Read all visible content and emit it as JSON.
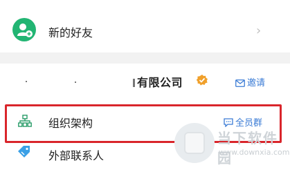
{
  "new_friends": {
    "label": "新的好友",
    "chevron": "›"
  },
  "company": {
    "name": "有限公司",
    "invite_label": "邀请"
  },
  "org_structure": {
    "label": "组织架构",
    "all_group_label": "全员群"
  },
  "external_contacts": {
    "label": "外部联系人"
  },
  "watermark": {
    "title": "当下软件园",
    "url": "www.downxia.com"
  },
  "colors": {
    "accent_green": "#22b573",
    "link_blue": "#3a7bd5",
    "highlight_red": "#d9252b",
    "verified_orange": "#f0a02b"
  },
  "icons": {
    "new_friends": "add-user-icon",
    "verified": "verified-badge-icon",
    "invite": "mail-icon",
    "org": "org-chart-icon",
    "group_chat": "chat-bubble-icon",
    "external": "tag-icon"
  }
}
